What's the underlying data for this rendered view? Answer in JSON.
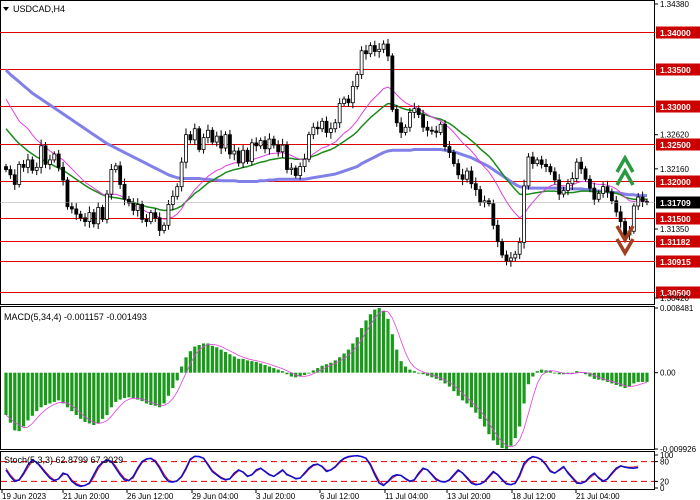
{
  "header": {
    "symbol_label": "USDCAD,H4",
    "macd_label": "MACD(5,34,4) -0.001157 -0.001493",
    "stoch_label": "Stoch(5,3,3) 62.8799 67.3029"
  },
  "colors": {
    "background": "#ffffff",
    "level_line": "#e00000",
    "level_box": "#cc0000",
    "ma_fast": "#e040e0",
    "ma_mid": "#1a8a1a",
    "ma_slow": "#8080e8",
    "candles": "#000000",
    "macd_hist": "#1a9a1a",
    "macd_signal": "#e040e0",
    "stoch_main": "#1010d0",
    "stoch_signal": "#e00000",
    "arrow_up": "#2a9a40",
    "arrow_down": "#a04020"
  },
  "icons": {
    "up": "double-chevron-up-arrow",
    "down": "double-chevron-down-arrow"
  },
  "chart_data": {
    "type": "candlestick",
    "symbol": "USDCAD",
    "timeframe": "H4",
    "price_axis": {
      "ylim": [
        1.3034,
        1.3442
      ],
      "ticks": [
        {
          "value": 1.3438,
          "label": "1.34380"
        },
        {
          "value": 1.3262,
          "label": "1.32620"
        },
        {
          "value": 1.3216,
          "label": "1.32160"
        },
        {
          "value": 1.3135,
          "label": "1.31350"
        },
        {
          "value": 1.3042,
          "label": "1.30420"
        }
      ]
    },
    "levels": [
      {
        "value": 1.34,
        "label": "1.34000"
      },
      {
        "value": 1.335,
        "label": "1.33500"
      },
      {
        "value": 1.33,
        "label": "1.33000"
      },
      {
        "value": 1.325,
        "label": "1.32500"
      },
      {
        "value": 1.32,
        "label": "1.32000"
      },
      {
        "value": 1.315,
        "label": "1.31500"
      },
      {
        "value": 1.31182,
        "label": "1.31182"
      },
      {
        "value": 1.30915,
        "label": "1.30915"
      },
      {
        "value": 1.305,
        "label": "1.30500"
      }
    ],
    "current_price": {
      "value": 1.31709,
      "label": "1.31709"
    },
    "x_labels": [
      "19 Jun 2023",
      "21 Jun 20:00",
      "26 Jun 12:00",
      "29 Jun 04:00",
      "3 Jul 20:00",
      "6 Jul 12:00",
      "11 Jul 04:00",
      "13 Jul 20:00",
      "18 Jul 12:00",
      "21 Jul 04:00"
    ],
    "close": [
      1.3215,
      1.3208,
      1.3195,
      1.3222,
      1.3218,
      1.3228,
      1.3214,
      1.3218,
      1.3247,
      1.3222,
      1.3228,
      1.3236,
      1.3218,
      1.3201,
      1.3165,
      1.3162,
      1.3155,
      1.315,
      1.3145,
      1.3157,
      1.3142,
      1.3164,
      1.3148,
      1.3182,
      1.3215,
      1.322,
      1.3195,
      1.3175,
      1.317,
      1.316,
      1.3168,
      1.3148,
      1.3145,
      1.3157,
      1.315,
      1.3133,
      1.314,
      1.3168,
      1.3179,
      1.3192,
      1.3225,
      1.3262,
      1.3255,
      1.327,
      1.3242,
      1.3258,
      1.3268,
      1.3252,
      1.326,
      1.3244,
      1.3262,
      1.3236,
      1.324,
      1.3224,
      1.3241,
      1.3226,
      1.3251,
      1.3247,
      1.3254,
      1.3243,
      1.3256,
      1.3248,
      1.3239,
      1.3248,
      1.3215,
      1.3217,
      1.3207,
      1.3219,
      1.3229,
      1.3262,
      1.3272,
      1.327,
      1.328,
      1.3265,
      1.327,
      1.3278,
      1.3304,
      1.331,
      1.3305,
      1.3327,
      1.3343,
      1.3375,
      1.3371,
      1.3382,
      1.3374,
      1.3377,
      1.3384,
      1.3368,
      1.3296,
      1.3278,
      1.3265,
      1.3272,
      1.3292,
      1.3297,
      1.3289,
      1.3272,
      1.3268,
      1.3267,
      1.3265,
      1.3276,
      1.3246,
      1.3238,
      1.3223,
      1.3208,
      1.3202,
      1.3213,
      1.3196,
      1.3188,
      1.3171,
      1.3173,
      1.3169,
      1.314,
      1.3118,
      1.31,
      1.3092,
      1.3096,
      1.3101,
      1.3117,
      1.3193,
      1.3232,
      1.3223,
      1.3228,
      1.3222,
      1.3219,
      1.3212,
      1.3201,
      1.3182,
      1.3187,
      1.3196,
      1.3203,
      1.3225,
      1.3216,
      1.3202,
      1.319,
      1.3175,
      1.3183,
      1.3192,
      1.3185,
      1.3173,
      1.3158,
      1.3145,
      1.3127,
      1.3132,
      1.3166,
      1.3178,
      1.3172,
      1.3171
    ],
    "ma_fast": [
      1.331,
      1.33,
      1.329,
      1.328,
      1.3275,
      1.327,
      1.3262,
      1.3255,
      1.325,
      1.3245,
      1.324,
      1.3236,
      1.3232,
      1.3228,
      1.3222,
      1.3216,
      1.321,
      1.3204,
      1.3198,
      1.3194,
      1.319,
      1.3186,
      1.3182,
      1.318,
      1.3181,
      1.3182,
      1.318,
      1.3176,
      1.3172,
      1.3168,
      1.3165,
      1.3162,
      1.3158,
      1.3156,
      1.3154,
      1.315,
      1.3148,
      1.3149,
      1.3151,
      1.3155,
      1.3162,
      1.3172,
      1.318,
      1.3188,
      1.3194,
      1.32,
      1.3206,
      1.321,
      1.3214,
      1.3216,
      1.322,
      1.3222,
      1.3224,
      1.3224,
      1.3226,
      1.3226,
      1.3228,
      1.323,
      1.3232,
      1.3234,
      1.3236,
      1.3237,
      1.3237,
      1.3238,
      1.3236,
      1.3234,
      1.3231,
      1.3229,
      1.3228,
      1.3232,
      1.3236,
      1.324,
      1.3244,
      1.3246,
      1.3249,
      1.3252,
      1.3258,
      1.3264,
      1.3268,
      1.3274,
      1.3281,
      1.329,
      1.3298,
      1.3306,
      1.3312,
      1.3318,
      1.3324,
      1.3326,
      1.3322,
      1.3316,
      1.331,
      1.3305,
      1.3302,
      1.33,
      1.3297,
      1.3293,
      1.3289,
      1.3286,
      1.3283,
      1.3281,
      1.3276,
      1.3271,
      1.3265,
      1.3258,
      1.3251,
      1.3246,
      1.324,
      1.3233,
      1.3225,
      1.3218,
      1.3212,
      1.3203,
      1.3193,
      1.3182,
      1.3172,
      1.3163,
      1.3156,
      1.315,
      1.3155,
      1.3164,
      1.3171,
      1.3178,
      1.3184,
      1.3189,
      1.3193,
      1.3195,
      1.3194,
      1.3193,
      1.3193,
      1.3194,
      1.3197,
      1.3199,
      1.3199,
      1.3198,
      1.3196,
      1.3195,
      1.3195,
      1.3194,
      1.3192,
      1.3189,
      1.3184,
      1.3178,
      1.3173,
      1.3172,
      1.3173,
      1.3173,
      1.3173
    ],
    "ma_mid": [
      1.327,
      1.3263,
      1.3256,
      1.325,
      1.3245,
      1.324,
      1.3236,
      1.3232,
      1.3229,
      1.3226,
      1.3223,
      1.322,
      1.3217,
      1.3214,
      1.321,
      1.3206,
      1.3202,
      1.3198,
      1.3194,
      1.319,
      1.3187,
      1.3184,
      1.3181,
      1.3179,
      1.3178,
      1.3177,
      1.3176,
      1.3175,
      1.3173,
      1.3171,
      1.3169,
      1.3167,
      1.3165,
      1.3164,
      1.3163,
      1.3161,
      1.316,
      1.316,
      1.3161,
      1.3163,
      1.3166,
      1.3172,
      1.3177,
      1.3183,
      1.3187,
      1.3192,
      1.3197,
      1.32,
      1.3204,
      1.3207,
      1.3211,
      1.3213,
      1.3215,
      1.3216,
      1.3218,
      1.3219,
      1.3221,
      1.3223,
      1.3225,
      1.3226,
      1.3228,
      1.3229,
      1.323,
      1.3231,
      1.323,
      1.323,
      1.3229,
      1.3229,
      1.3229,
      1.3231,
      1.3233,
      1.3235,
      1.3238,
      1.324,
      1.3242,
      1.3245,
      1.3249,
      1.3253,
      1.3257,
      1.3261,
      1.3266,
      1.3273,
      1.3279,
      1.3285,
      1.329,
      1.3295,
      1.33,
      1.3304,
      1.3303,
      1.3301,
      1.3298,
      1.3296,
      1.3295,
      1.3294,
      1.3292,
      1.329,
      1.3288,
      1.3286,
      1.3284,
      1.3283,
      1.328,
      1.3277,
      1.3273,
      1.3268,
      1.3263,
      1.3259,
      1.3254,
      1.3249,
      1.3243,
      1.3238,
      1.3233,
      1.3226,
      1.3218,
      1.321,
      1.3202,
      1.3195,
      1.3188,
      1.3182,
      1.3181,
      1.3182,
      1.3183,
      1.3184,
      1.3185,
      1.3186,
      1.3186,
      1.3186,
      1.3185,
      1.3184,
      1.3184,
      1.3184,
      1.3185,
      1.3186,
      1.3186,
      1.3186,
      1.3185,
      1.3185,
      1.3185,
      1.3185,
      1.3184,
      1.3183,
      1.3181,
      1.3178,
      1.3176,
      1.3175,
      1.3175,
      1.3175,
      1.3175
    ],
    "ma_slow": [
      1.3349,
      1.3343,
      1.3338,
      1.3333,
      1.3328,
      1.3323,
      1.3318,
      1.3314,
      1.331,
      1.3306,
      1.3302,
      1.3298,
      1.3294,
      1.329,
      1.3286,
      1.3282,
      1.3278,
      1.3274,
      1.327,
      1.3266,
      1.3262,
      1.3258,
      1.3254,
      1.325,
      1.3247,
      1.3244,
      1.3241,
      1.3238,
      1.3235,
      1.3232,
      1.3229,
      1.3226,
      1.3223,
      1.322,
      1.3217,
      1.3214,
      1.3211,
      1.3208,
      1.3206,
      1.3204,
      1.3203,
      1.3203,
      1.3203,
      1.3203,
      1.3203,
      1.3202,
      1.3202,
      1.3201,
      1.3201,
      1.32,
      1.32,
      1.32,
      1.32,
      1.3199,
      1.3199,
      1.3199,
      1.3199,
      1.3199,
      1.32,
      1.32,
      1.3201,
      1.3201,
      1.3202,
      1.3202,
      1.3202,
      1.3202,
      1.3202,
      1.3202,
      1.3202,
      1.3203,
      1.3204,
      1.3205,
      1.3206,
      1.3207,
      1.3208,
      1.3209,
      1.3211,
      1.3213,
      1.3215,
      1.3217,
      1.3219,
      1.3223,
      1.3226,
      1.3229,
      1.3232,
      1.3235,
      1.3238,
      1.324,
      1.3241,
      1.3241,
      1.3241,
      1.3241,
      1.3241,
      1.3242,
      1.3242,
      1.3242,
      1.3242,
      1.3242,
      1.3242,
      1.3242,
      1.3241,
      1.324,
      1.3239,
      1.3237,
      1.3235,
      1.3233,
      1.3231,
      1.3228,
      1.3225,
      1.3222,
      1.3219,
      1.3215,
      1.3211,
      1.3207,
      1.3203,
      1.3199,
      1.3195,
      1.3192,
      1.3191,
      1.319,
      1.319,
      1.319,
      1.319,
      1.319,
      1.319,
      1.319,
      1.319,
      1.319,
      1.3189,
      1.3189,
      1.3189,
      1.3189,
      1.3188,
      1.3188,
      1.3187,
      1.3186,
      1.3186,
      1.3185,
      1.3184,
      1.3184,
      1.3183,
      1.3182,
      1.3181,
      1.3181,
      1.318,
      1.318,
      1.318
    ],
    "macd": {
      "label": "MACD(5,34,4)",
      "main": -0.001157,
      "signal": -0.001493,
      "ylim": [
        -0.00992,
        0.00841
      ],
      "ticks": [
        {
          "value": 0.00841,
          "label": "0.008481"
        },
        {
          "value": 0.0,
          "label": "0.00"
        },
        {
          "value": -0.00992,
          "label": "-0.009926"
        }
      ],
      "hist": [
        -0.0055,
        -0.0065,
        -0.0075,
        -0.0076,
        -0.007,
        -0.0062,
        -0.0056,
        -0.005,
        -0.0045,
        -0.0042,
        -0.004,
        -0.0038,
        -0.0036,
        -0.004,
        -0.0045,
        -0.005,
        -0.0055,
        -0.006,
        -0.0064,
        -0.0066,
        -0.0068,
        -0.0066,
        -0.006,
        -0.0055,
        -0.0045,
        -0.0038,
        -0.0035,
        -0.0033,
        -0.0032,
        -0.0033,
        -0.0035,
        -0.0037,
        -0.004,
        -0.0042,
        -0.0043,
        -0.0045,
        -0.004,
        -0.003,
        -0.002,
        -0.001,
        0.0008,
        0.002,
        0.0028,
        0.0034,
        0.0036,
        0.0038,
        0.0038,
        0.0035,
        0.0033,
        0.003,
        0.0027,
        0.0024,
        0.0021,
        0.0018,
        0.0018,
        0.0016,
        0.0015,
        0.0014,
        0.0012,
        0.001,
        0.0008,
        0.0006,
        0.0004,
        0.0002,
        -0.0002,
        -0.0005,
        -0.0006,
        -0.0005,
        -0.0003,
        -0.0001,
        0.0003,
        0.0006,
        0.0009,
        0.0011,
        0.0013,
        0.0016,
        0.002,
        0.0025,
        0.003,
        0.0038,
        0.0046,
        0.0058,
        0.0068,
        0.0076,
        0.0082,
        0.0084,
        0.008,
        0.007,
        0.005,
        0.003,
        0.0015,
        0.0008,
        0.0004,
        0.0002,
        0.0,
        -0.0002,
        -0.0004,
        -0.0006,
        -0.0008,
        -0.001,
        -0.0014,
        -0.0018,
        -0.0024,
        -0.003,
        -0.0036,
        -0.004,
        -0.0045,
        -0.0052,
        -0.006,
        -0.007,
        -0.008,
        -0.0088,
        -0.0094,
        -0.0098,
        -0.0099,
        -0.0095,
        -0.0085,
        -0.007,
        -0.004,
        -0.0015,
        -0.0005,
        0.0002,
        0.0004,
        0.0003,
        0.0002,
        0.0,
        -0.0002,
        -0.0002,
        -0.0001,
        0.0,
        0.0002,
        0.0001,
        -0.0002,
        -0.0005,
        -0.0008,
        -0.0009,
        -0.001,
        -0.0012,
        -0.0014,
        -0.0016,
        -0.0018,
        -0.002,
        -0.0018,
        -0.0014,
        -0.0012,
        -0.0012,
        -0.0012
      ]
    },
    "stochastic": {
      "label": "Stoch(5,3,3)",
      "main": 62.8799,
      "signal": 67.3029,
      "ylim": [
        0,
        100
      ],
      "ticks": [
        {
          "value": 100,
          "label": "100"
        },
        {
          "value": 80,
          "label": "80"
        },
        {
          "value": 20,
          "label": "20"
        },
        {
          "value": 0,
          "label": "0"
        }
      ],
      "levels": [
        80,
        20
      ],
      "k": [
        55,
        35,
        20,
        25,
        45,
        70,
        85,
        78,
        62,
        45,
        30,
        22,
        28,
        45,
        40,
        20,
        10,
        5,
        8,
        15,
        40,
        65,
        78,
        85,
        80,
        60,
        40,
        25,
        22,
        35,
        60,
        80,
        88,
        90,
        80,
        60,
        35,
        20,
        18,
        22,
        35,
        60,
        88,
        96,
        95,
        90,
        70,
        50,
        40,
        30,
        25,
        28,
        45,
        55,
        48,
        35,
        40,
        55,
        60,
        50,
        40,
        35,
        45,
        55,
        40,
        35,
        28,
        30,
        45,
        60,
        70,
        72,
        65,
        50,
        55,
        65,
        80,
        90,
        95,
        97,
        98,
        95,
        90,
        70,
        40,
        15,
        8,
        20,
        35,
        40,
        38,
        28,
        20,
        25,
        45,
        60,
        55,
        40,
        25,
        20,
        18,
        25,
        40,
        55,
        45,
        30,
        15,
        10,
        12,
        20,
        35,
        50,
        40,
        25,
        12,
        10,
        15,
        40,
        75,
        88,
        95,
        92,
        85,
        70,
        50,
        45,
        55,
        65,
        45,
        30,
        15,
        14,
        20,
        35,
        45,
        30,
        20,
        28,
        45,
        60,
        67,
        63,
        61,
        60,
        62
      ],
      "d": [
        60,
        40,
        25,
        22,
        40,
        62,
        80,
        80,
        66,
        50,
        35,
        25,
        27,
        40,
        42,
        25,
        14,
        8,
        8,
        12,
        32,
        58,
        75,
        83,
        82,
        66,
        46,
        30,
        24,
        30,
        55,
        76,
        86,
        90,
        84,
        66,
        42,
        25,
        19,
        21,
        32,
        55,
        84,
        95,
        96,
        91,
        74,
        54,
        43,
        33,
        27,
        27,
        40,
        52,
        50,
        38,
        39,
        51,
        58,
        52,
        42,
        36,
        42,
        52,
        43,
        36,
        30,
        30,
        41,
        56,
        67,
        71,
        67,
        54,
        54,
        62,
        76,
        88,
        93,
        96,
        98,
        96,
        91,
        75,
        47,
        22,
        11,
        17,
        30,
        38,
        38,
        30,
        22,
        23,
        40,
        56,
        56,
        43,
        29,
        21,
        18,
        22,
        36,
        51,
        47,
        34,
        19,
        12,
        12,
        18,
        31,
        46,
        42,
        28,
        15,
        11,
        13,
        34,
        68,
        85,
        93,
        93,
        87,
        73,
        54,
        46,
        52,
        62,
        49,
        34,
        19,
        15,
        18,
        30,
        41,
        33,
        23,
        26,
        41,
        56,
        65,
        65,
        63,
        64,
        67
      ]
    }
  }
}
